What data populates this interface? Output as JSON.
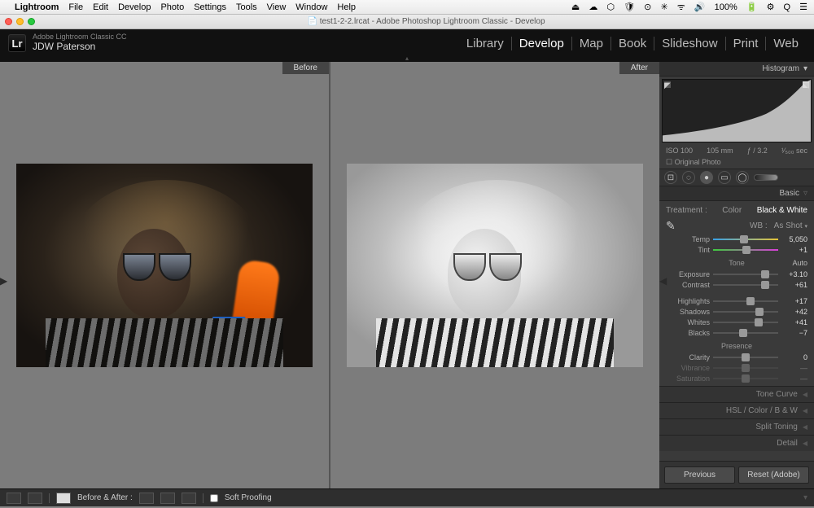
{
  "mac": {
    "app_name": "Lightroom",
    "menus": [
      "File",
      "Edit",
      "Develop",
      "Photo",
      "Settings",
      "Tools",
      "View",
      "Window",
      "Help"
    ],
    "right": [
      "⏏",
      "☁",
      "⬡",
      "🛡",
      "⊙",
      "✳",
      "ᯤ",
      "🔊",
      "100%",
      "🔋",
      "⚙",
      "Q",
      "☰"
    ],
    "window_title": "test1-2-2.lrcat - Adobe Photoshop Lightroom Classic - Develop"
  },
  "identity": {
    "logo": "Lr",
    "line1": "Adobe Lightroom Classic CC",
    "line2": "JDW Paterson"
  },
  "modules": [
    "Library",
    "Develop",
    "Map",
    "Book",
    "Slideshow",
    "Print",
    "Web"
  ],
  "active_module": "Develop",
  "compare": {
    "left": "Before",
    "right": "After"
  },
  "histogram": {
    "title": "Histogram",
    "iso": "ISO 100",
    "focal": "105 mm",
    "aperture": "ƒ / 3.2",
    "shutter": "¹⁄₅₀₀ sec",
    "orig": "Original Photo"
  },
  "basic": {
    "title": "Basic",
    "treatment_label": "Treatment :",
    "color": "Color",
    "bw": "Black & White",
    "wb_label": "WB :",
    "wb_value": "As Shot",
    "temp": {
      "label": "Temp",
      "value": "5,050",
      "pos": 48
    },
    "tint": {
      "label": "Tint",
      "value": "+1",
      "pos": 51
    },
    "tone_label": "Tone",
    "auto": "Auto",
    "exposure": {
      "label": "Exposure",
      "value": "+3.10",
      "pos": 80
    },
    "contrast": {
      "label": "Contrast",
      "value": "+61",
      "pos": 80
    },
    "highlights": {
      "label": "Highlights",
      "value": "+17",
      "pos": 58
    },
    "shadows": {
      "label": "Shadows",
      "value": "+42",
      "pos": 71
    },
    "whites": {
      "label": "Whites",
      "value": "+41",
      "pos": 70
    },
    "blacks": {
      "label": "Blacks",
      "value": "−7",
      "pos": 46
    },
    "presence_label": "Presence",
    "clarity": {
      "label": "Clarity",
      "value": "0",
      "pos": 50
    },
    "vibrance": {
      "label": "Vibrance",
      "value": "—",
      "pos": 50
    },
    "saturation": {
      "label": "Saturation",
      "value": "—",
      "pos": 50
    }
  },
  "collapsed_panels": [
    "Tone Curve",
    "HSL / Color / B & W",
    "Split Toning",
    "Detail"
  ],
  "rp_buttons": {
    "prev": "Previous",
    "reset": "Reset (Adobe)"
  },
  "bottom": {
    "before_after": "Before & After :",
    "soft_proof": "Soft Proofing"
  }
}
